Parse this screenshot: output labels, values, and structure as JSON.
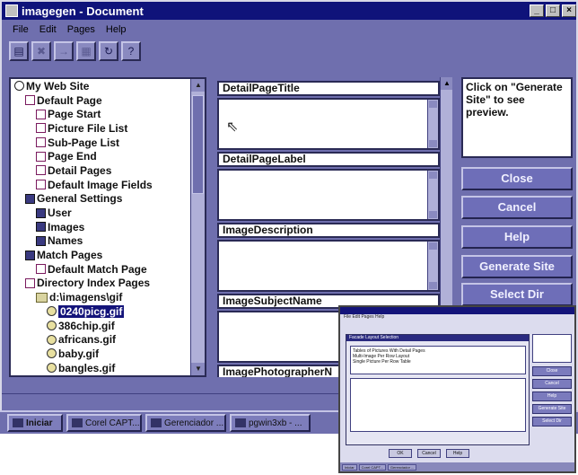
{
  "window": {
    "title": "imagegen - Document",
    "controls": [
      "_",
      "□",
      "×"
    ]
  },
  "menubar": [
    "File",
    "Edit",
    "Pages",
    "Help"
  ],
  "toolbar": {
    "buttons": [
      {
        "icon": "new-page-icon",
        "glyph": "▤",
        "enabled": true
      },
      {
        "icon": "delete-icon",
        "glyph": "✖",
        "enabled": false
      },
      {
        "icon": "move-icon",
        "glyph": "→",
        "enabled": false
      },
      {
        "icon": "properties-icon",
        "glyph": "▦",
        "enabled": false
      },
      {
        "icon": "refresh-icon",
        "glyph": "↻",
        "enabled": true
      },
      {
        "icon": "help-icon",
        "glyph": "?",
        "enabled": true
      }
    ]
  },
  "tree": {
    "items": [
      {
        "label": "My Web Site",
        "level": 0,
        "icon": "root"
      },
      {
        "label": "Default Page",
        "level": 1,
        "icon": "page"
      },
      {
        "label": "Page Start",
        "level": 2,
        "icon": "page"
      },
      {
        "label": "Picture File List",
        "level": 2,
        "icon": "page"
      },
      {
        "label": "Sub-Page List",
        "level": 2,
        "icon": "page"
      },
      {
        "label": "Page End",
        "level": 2,
        "icon": "page"
      },
      {
        "label": "Detail Pages",
        "level": 2,
        "icon": "page"
      },
      {
        "label": "Default Image Fields",
        "level": 2,
        "icon": "page"
      },
      {
        "label": "General Settings",
        "level": 1,
        "icon": "settings"
      },
      {
        "label": "User",
        "level": 2,
        "icon": "settings"
      },
      {
        "label": "Images",
        "level": 2,
        "icon": "settings"
      },
      {
        "label": "Names",
        "level": 2,
        "icon": "settings"
      },
      {
        "label": "Match Pages",
        "level": 1,
        "icon": "settings"
      },
      {
        "label": "Default Match Page",
        "level": 2,
        "icon": "page"
      },
      {
        "label": "Directory Index Pages",
        "level": 1,
        "icon": "page"
      },
      {
        "label": "d:\\imagens\\gif",
        "level": 2,
        "icon": "folder"
      },
      {
        "label": "0240picg.gif",
        "level": 3,
        "icon": "image",
        "selected": true
      },
      {
        "label": "386chip.gif",
        "level": 3,
        "icon": "image"
      },
      {
        "label": "africans.gif",
        "level": 3,
        "icon": "image"
      },
      {
        "label": "baby.gif",
        "level": 3,
        "icon": "image"
      },
      {
        "label": "bangles.gif",
        "level": 3,
        "icon": "image"
      }
    ]
  },
  "fields": [
    {
      "label": "DetailPageTitle",
      "value": ""
    },
    {
      "label": "DetailPageLabel",
      "value": ""
    },
    {
      "label": "ImageDescription",
      "value": ""
    },
    {
      "label": "ImageSubjectName",
      "value": ""
    },
    {
      "label": "ImagePhotographerN",
      "value": ""
    }
  ],
  "preview": {
    "text": "Click on \"Generate Site\" to see preview."
  },
  "actions": {
    "close": "Close",
    "cancel": "Cancel",
    "help": "Help",
    "generate": "Generate Site",
    "select_dir": "Select Dir"
  },
  "taskbar": {
    "start": "Iniciar",
    "tasks": [
      "Corel CAPT...",
      "Gerenciador ...",
      "pgwin3xb - ..."
    ]
  },
  "inset": {
    "dialog_title": "Facade Layout Selection",
    "list_items": [
      "Tables of Pictures With Detail Pages",
      "Multi-Image Per Row Layout",
      "Single Picture Per Row Table"
    ],
    "buttons": [
      "OK",
      "Cancel",
      "Help"
    ],
    "side_buttons": [
      "Close",
      "Cancel",
      "Help",
      "Generate Site",
      "Select Dir"
    ]
  }
}
